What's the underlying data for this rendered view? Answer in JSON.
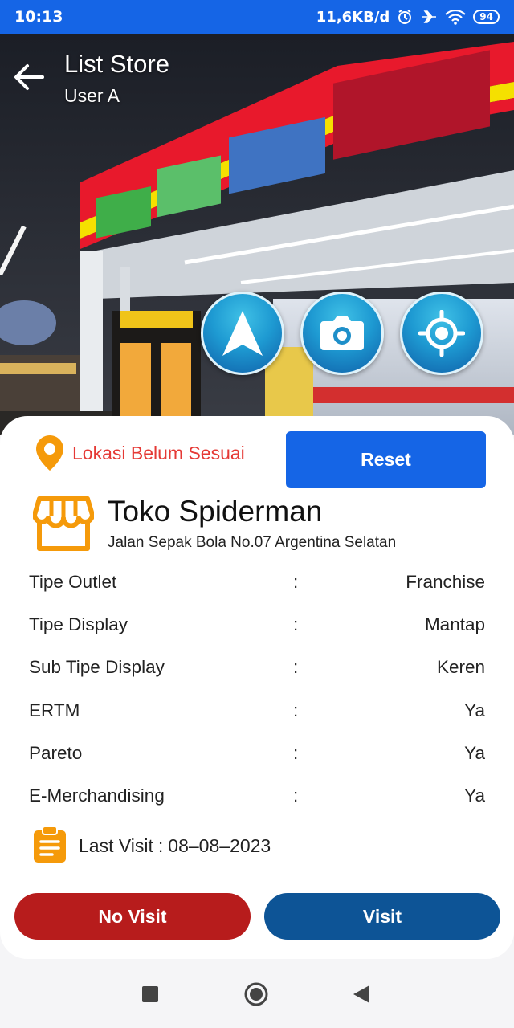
{
  "status_bar": {
    "time": "10:13",
    "network_speed": "11,6KB/d",
    "battery": "94"
  },
  "app_bar": {
    "title": "List Store",
    "subtitle": "User A"
  },
  "actions": {
    "navigate_icon": "navigation-arrow-icon",
    "camera_icon": "camera-icon",
    "locate_icon": "gps-crosshair-icon"
  },
  "location": {
    "status_text": "Lokasi Belum Sesuai",
    "reset_label": "Reset"
  },
  "store": {
    "name": "Toko Spiderman",
    "address": "Jalan Sepak Bola No.07 Argentina Selatan"
  },
  "details": [
    {
      "label": "Tipe Outlet",
      "colon": ":",
      "value": "Franchise"
    },
    {
      "label": "Tipe Display",
      "colon": ":",
      "value": "Mantap"
    },
    {
      "label": "Sub Tipe Display",
      "colon": ":",
      "value": "Keren"
    },
    {
      "label": "ERTM",
      "colon": ":",
      "value": "Ya"
    },
    {
      "label": "Pareto",
      "colon": ":",
      "value": "Ya"
    },
    {
      "label": "E-Merchandising",
      "colon": ":",
      "value": "Ya"
    }
  ],
  "last_visit": {
    "label": "Last Visit",
    "separator": ":",
    "date": "08–08–2023"
  },
  "buttons": {
    "no_visit": "No Visit",
    "visit": "Visit"
  },
  "colors": {
    "primary": "#1565e6",
    "accent_orange": "#f59a0a",
    "warning_red": "#e53935",
    "no_visit_red": "#b71c1c",
    "visit_blue": "#0d5496"
  }
}
